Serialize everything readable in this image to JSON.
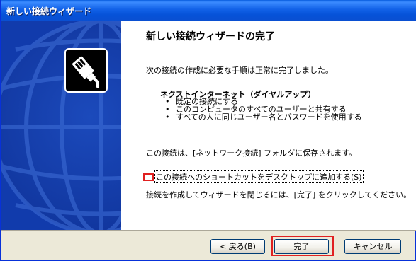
{
  "window": {
    "title": "新しい接続ウィザード"
  },
  "content": {
    "heading": "新しい接続ウィザードの完了",
    "intro": "次の接続の作成に必要な手順は正常に完了しました。",
    "connection_name": "ネクストインターネット（ダイヤルアップ）",
    "details": [
      "既定の接続にする",
      "このコンピュータのすべてのユーザーと共有する",
      "すべての人に同じユーザー名とパスワードを使用する"
    ],
    "saved_note": "この接続は、[ネットワーク接続] フォルダに保存されます。",
    "shortcut_checkbox": {
      "label": "この接続へのショートカットをデスクトップに追加する(S)",
      "checked": false
    },
    "finish_note": "接続を作成してウィザードを閉じるには、[完了] をクリックしてください。"
  },
  "buttons": {
    "back": "< 戻る(B)",
    "finish": "完了",
    "cancel": "キャンセル"
  },
  "colors": {
    "titlebar": "#0A5FE0",
    "left_panel": "#113BAC",
    "highlight": "#E02020"
  },
  "icons": {
    "titlebar_icon": "none",
    "wizard_icon": "network-cable-plug-icon",
    "background_art": "globe-icon"
  }
}
